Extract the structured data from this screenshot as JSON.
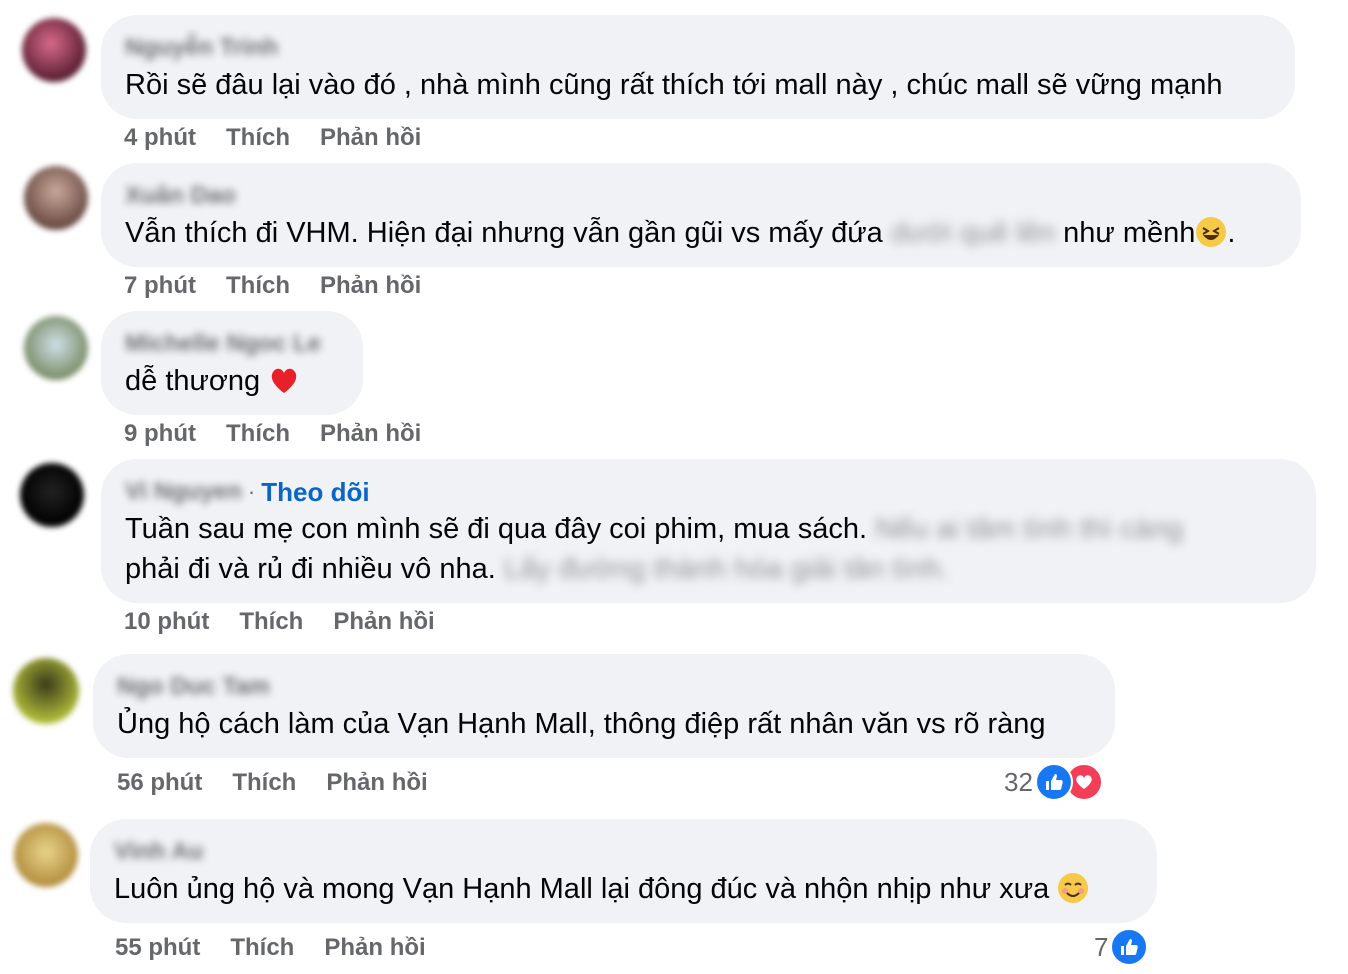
{
  "comments": [
    {
      "author": "Nguyễn Trinh",
      "text": "Rồi sẽ đâu lại vào đó , nhà mình cũng rất thích tới mall này , chúc mall sẽ vững mạnh",
      "time": "4 phút",
      "like_label": "Thích",
      "reply_label": "Phản hồi"
    },
    {
      "author": "Xuân Dao",
      "text_before": "Vẫn thích đi VHM. Hiện đại nhưng vẫn gần gũi vs mấy đứa",
      "text_hidden": "dưới quê lên",
      "text_after": "như mềnh",
      "text_end": ".",
      "emoji": "laughing-emoji",
      "time": "7 phút",
      "like_label": "Thích",
      "reply_label": "Phản hồi"
    },
    {
      "author": "Michelle Ngoc Le",
      "text": "dễ thương",
      "emoji": "heart-emoji",
      "time": "9 phút",
      "like_label": "Thích",
      "reply_label": "Phản hồi"
    },
    {
      "author": "Vi Nguyen",
      "follow_label": "Theo dõi",
      "line1": "Tuần sau mẹ con mình sẽ đi qua đây coi phim, mua sách.",
      "line1_hidden": "Nếu ai tâm tình thì càng",
      "line2": "phải đi và rủ đi nhiều vô nha.",
      "line2_hidden": "Lấy đường thành hóa giải tân tình.",
      "time": "10 phút",
      "like_label": "Thích",
      "reply_label": "Phản hồi"
    },
    {
      "author": "Ngo Duc Tam",
      "text": "Ủng hộ cách làm của Vạn Hạnh Mall, thông điệp rất nhân văn vs rõ ràng",
      "time": "56 phút",
      "like_label": "Thích",
      "reply_label": "Phản hồi",
      "reaction_count": "32",
      "reactions": [
        "like-icon",
        "love-icon"
      ]
    },
    {
      "author": "Vinh Au",
      "text": "Luôn ủng hộ và mong Vạn Hạnh Mall lại đông đúc và nhộn nhịp như xưa",
      "emoji": "smiling-emoji",
      "time": "55 phút",
      "like_label": "Thích",
      "reply_label": "Phản hồi",
      "reaction_count": "7",
      "reactions": [
        "like-icon"
      ]
    }
  ],
  "colors": {
    "bubble": "#f0f2f5",
    "meta": "#65676b",
    "link": "#0866c9",
    "like": "#1877f2",
    "love": "#f33e58"
  }
}
